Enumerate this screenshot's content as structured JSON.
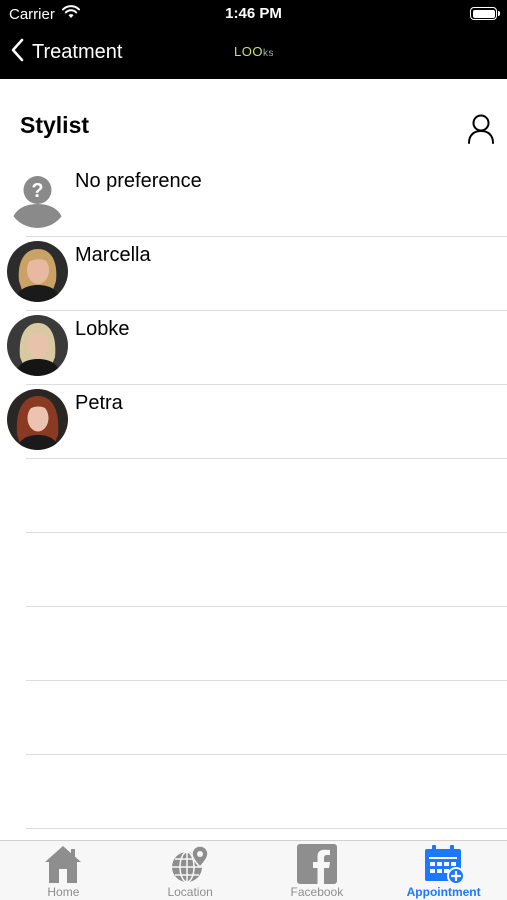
{
  "status_bar": {
    "carrier": "Carrier",
    "time": "1:46 PM"
  },
  "nav": {
    "back_label": "Treatment",
    "logo_main": "LOO",
    "logo_suffix": "ks"
  },
  "section": {
    "title": "Stylist"
  },
  "stylists": [
    {
      "name": "No preference",
      "avatar": "placeholder-question-avatar"
    },
    {
      "name": "Marcella",
      "avatar": "photo-blonde-woman"
    },
    {
      "name": "Lobke",
      "avatar": "photo-blonde-woman"
    },
    {
      "name": "Petra",
      "avatar": "photo-redhead-woman"
    }
  ],
  "tabs": [
    {
      "label": "Home",
      "icon": "home-icon",
      "active": false
    },
    {
      "label": "Location",
      "icon": "globe-pin-icon",
      "active": false
    },
    {
      "label": "Facebook",
      "icon": "facebook-icon",
      "active": false
    },
    {
      "label": "Appointment",
      "icon": "calendar-add-icon",
      "active": true
    }
  ],
  "colors": {
    "accent": "#1e78ff",
    "topbar": "#000000",
    "logo": "#c8e07a"
  }
}
